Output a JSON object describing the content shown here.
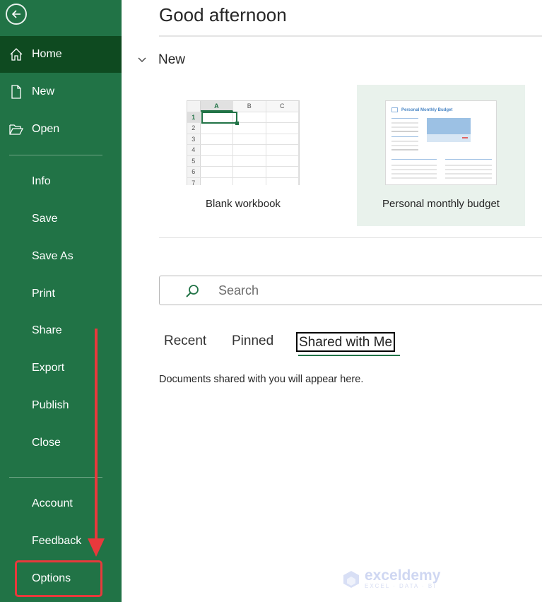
{
  "sidebar": {
    "back_icon": "arrow-left-circle-icon",
    "items": [
      {
        "label": "Home",
        "icon": "home-icon",
        "active": true
      },
      {
        "label": "New",
        "icon": "new-document-icon"
      },
      {
        "label": "Open",
        "icon": "folder-open-icon"
      },
      {
        "label": "Info"
      },
      {
        "label": "Save"
      },
      {
        "label": "Save As"
      },
      {
        "label": "Print"
      },
      {
        "label": "Share"
      },
      {
        "label": "Export"
      },
      {
        "label": "Publish"
      },
      {
        "label": "Close"
      },
      {
        "label": "Account"
      },
      {
        "label": "Feedback"
      },
      {
        "label": "Options",
        "highlighted": true
      }
    ]
  },
  "main": {
    "greeting": "Good afternoon",
    "new_section": {
      "label": "New",
      "templates": [
        {
          "label": "Blank workbook",
          "columns": [
            "A",
            "B",
            "C"
          ],
          "rows": [
            "1",
            "2",
            "3",
            "4",
            "5",
            "6",
            "7"
          ]
        },
        {
          "label": "Personal monthly budget",
          "preview_title": "Personal Monthly Budget"
        }
      ]
    },
    "search": {
      "placeholder": "Search",
      "value": ""
    },
    "tabs": [
      {
        "label": "Recent"
      },
      {
        "label": "Pinned"
      },
      {
        "label": "Shared with Me",
        "active": true
      }
    ],
    "empty_message": "Documents shared with you will appear here."
  },
  "annotation": {
    "color": "#e8393c",
    "target": "Options"
  },
  "watermark": {
    "name": "exceldemy",
    "tagline": "EXCEL · DATA · BI"
  },
  "colors": {
    "sidebar_bg": "#217346",
    "sidebar_active": "#0e4a20",
    "accent": "#217346"
  }
}
